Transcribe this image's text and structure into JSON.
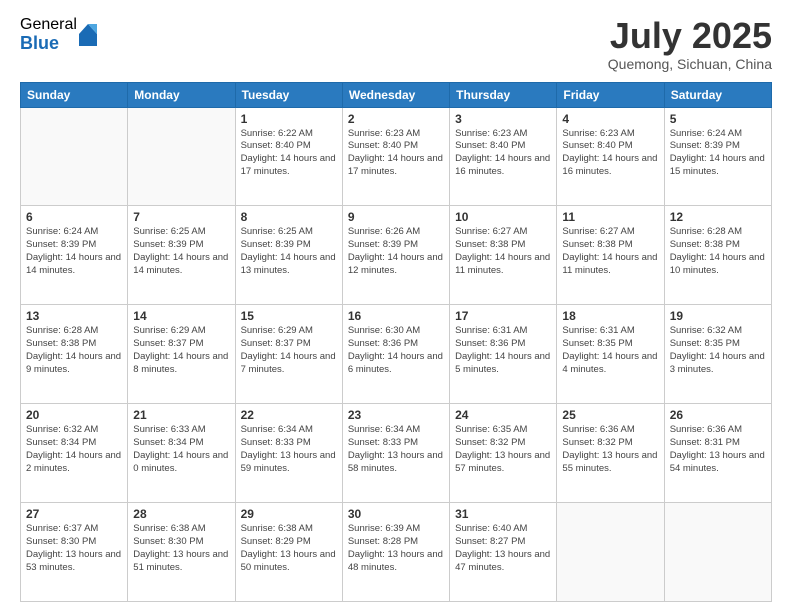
{
  "header": {
    "logo_general": "General",
    "logo_blue": "Blue",
    "month_title": "July 2025",
    "location": "Quemong, Sichuan, China"
  },
  "days_of_week": [
    "Sunday",
    "Monday",
    "Tuesday",
    "Wednesday",
    "Thursday",
    "Friday",
    "Saturday"
  ],
  "weeks": [
    [
      {
        "day": "",
        "info": ""
      },
      {
        "day": "",
        "info": ""
      },
      {
        "day": "1",
        "info": "Sunrise: 6:22 AM\nSunset: 8:40 PM\nDaylight: 14 hours and 17 minutes."
      },
      {
        "day": "2",
        "info": "Sunrise: 6:23 AM\nSunset: 8:40 PM\nDaylight: 14 hours and 17 minutes."
      },
      {
        "day": "3",
        "info": "Sunrise: 6:23 AM\nSunset: 8:40 PM\nDaylight: 14 hours and 16 minutes."
      },
      {
        "day": "4",
        "info": "Sunrise: 6:23 AM\nSunset: 8:40 PM\nDaylight: 14 hours and 16 minutes."
      },
      {
        "day": "5",
        "info": "Sunrise: 6:24 AM\nSunset: 8:39 PM\nDaylight: 14 hours and 15 minutes."
      }
    ],
    [
      {
        "day": "6",
        "info": "Sunrise: 6:24 AM\nSunset: 8:39 PM\nDaylight: 14 hours and 14 minutes."
      },
      {
        "day": "7",
        "info": "Sunrise: 6:25 AM\nSunset: 8:39 PM\nDaylight: 14 hours and 14 minutes."
      },
      {
        "day": "8",
        "info": "Sunrise: 6:25 AM\nSunset: 8:39 PM\nDaylight: 14 hours and 13 minutes."
      },
      {
        "day": "9",
        "info": "Sunrise: 6:26 AM\nSunset: 8:39 PM\nDaylight: 14 hours and 12 minutes."
      },
      {
        "day": "10",
        "info": "Sunrise: 6:27 AM\nSunset: 8:38 PM\nDaylight: 14 hours and 11 minutes."
      },
      {
        "day": "11",
        "info": "Sunrise: 6:27 AM\nSunset: 8:38 PM\nDaylight: 14 hours and 11 minutes."
      },
      {
        "day": "12",
        "info": "Sunrise: 6:28 AM\nSunset: 8:38 PM\nDaylight: 14 hours and 10 minutes."
      }
    ],
    [
      {
        "day": "13",
        "info": "Sunrise: 6:28 AM\nSunset: 8:38 PM\nDaylight: 14 hours and 9 minutes."
      },
      {
        "day": "14",
        "info": "Sunrise: 6:29 AM\nSunset: 8:37 PM\nDaylight: 14 hours and 8 minutes."
      },
      {
        "day": "15",
        "info": "Sunrise: 6:29 AM\nSunset: 8:37 PM\nDaylight: 14 hours and 7 minutes."
      },
      {
        "day": "16",
        "info": "Sunrise: 6:30 AM\nSunset: 8:36 PM\nDaylight: 14 hours and 6 minutes."
      },
      {
        "day": "17",
        "info": "Sunrise: 6:31 AM\nSunset: 8:36 PM\nDaylight: 14 hours and 5 minutes."
      },
      {
        "day": "18",
        "info": "Sunrise: 6:31 AM\nSunset: 8:35 PM\nDaylight: 14 hours and 4 minutes."
      },
      {
        "day": "19",
        "info": "Sunrise: 6:32 AM\nSunset: 8:35 PM\nDaylight: 14 hours and 3 minutes."
      }
    ],
    [
      {
        "day": "20",
        "info": "Sunrise: 6:32 AM\nSunset: 8:34 PM\nDaylight: 14 hours and 2 minutes."
      },
      {
        "day": "21",
        "info": "Sunrise: 6:33 AM\nSunset: 8:34 PM\nDaylight: 14 hours and 0 minutes."
      },
      {
        "day": "22",
        "info": "Sunrise: 6:34 AM\nSunset: 8:33 PM\nDaylight: 13 hours and 59 minutes."
      },
      {
        "day": "23",
        "info": "Sunrise: 6:34 AM\nSunset: 8:33 PM\nDaylight: 13 hours and 58 minutes."
      },
      {
        "day": "24",
        "info": "Sunrise: 6:35 AM\nSunset: 8:32 PM\nDaylight: 13 hours and 57 minutes."
      },
      {
        "day": "25",
        "info": "Sunrise: 6:36 AM\nSunset: 8:32 PM\nDaylight: 13 hours and 55 minutes."
      },
      {
        "day": "26",
        "info": "Sunrise: 6:36 AM\nSunset: 8:31 PM\nDaylight: 13 hours and 54 minutes."
      }
    ],
    [
      {
        "day": "27",
        "info": "Sunrise: 6:37 AM\nSunset: 8:30 PM\nDaylight: 13 hours and 53 minutes."
      },
      {
        "day": "28",
        "info": "Sunrise: 6:38 AM\nSunset: 8:30 PM\nDaylight: 13 hours and 51 minutes."
      },
      {
        "day": "29",
        "info": "Sunrise: 6:38 AM\nSunset: 8:29 PM\nDaylight: 13 hours and 50 minutes."
      },
      {
        "day": "30",
        "info": "Sunrise: 6:39 AM\nSunset: 8:28 PM\nDaylight: 13 hours and 48 minutes."
      },
      {
        "day": "31",
        "info": "Sunrise: 6:40 AM\nSunset: 8:27 PM\nDaylight: 13 hours and 47 minutes."
      },
      {
        "day": "",
        "info": ""
      },
      {
        "day": "",
        "info": ""
      }
    ]
  ]
}
